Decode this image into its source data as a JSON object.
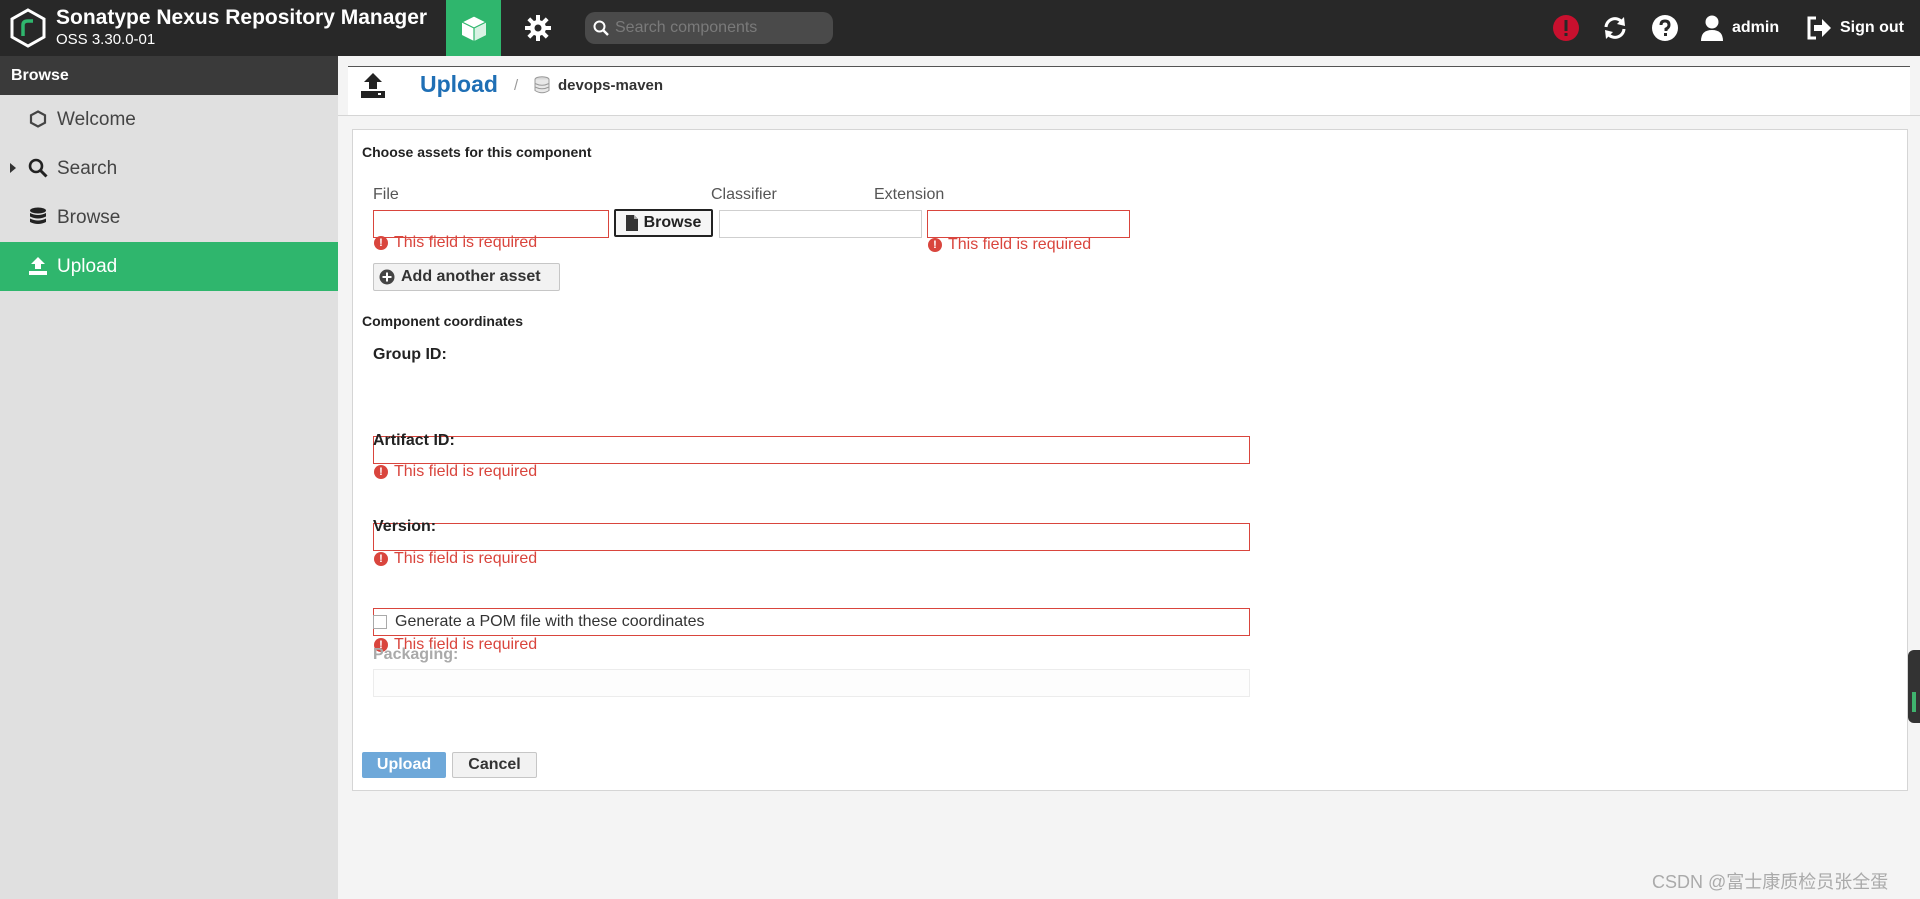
{
  "header": {
    "app_title": "Sonatype Nexus Repository Manager",
    "version": "OSS 3.30.0-01",
    "search_placeholder": "Search components",
    "user_name": "admin",
    "sign_out_label": "Sign out",
    "icons": [
      "nexus-logo-icon",
      "cube-icon",
      "gear-icon",
      "search-icon",
      "alert-icon",
      "refresh-icon",
      "help-icon",
      "user-icon",
      "sign-out-icon"
    ],
    "accent_color": "#2fb66d"
  },
  "sidebar": {
    "header": "Browse",
    "items": [
      {
        "label": "Welcome",
        "icon": "hexagon-icon"
      },
      {
        "label": "Search",
        "icon": "search-icon"
      },
      {
        "label": "Browse",
        "icon": "database-icon"
      },
      {
        "label": "Upload",
        "icon": "upload-icon",
        "active": true
      }
    ]
  },
  "title_bar": {
    "title": "Upload",
    "separator": "/",
    "repository": "devops-maven"
  },
  "form": {
    "assets_section_title": "Choose assets for this component",
    "file_label": "File",
    "classifier_label": "Classifier",
    "extension_label": "Extension",
    "browse_label": "Browse",
    "required_error": "This field is required",
    "add_asset_label": "Add another asset",
    "coordinates_section_title": "Component coordinates",
    "group_id_label": "Group ID:",
    "artifact_id_label": "Artifact ID:",
    "version_label": "Version:",
    "pom_checkbox_label": "Generate a POM file with these coordinates",
    "pom_checked": false,
    "packaging_label": "Packaging:",
    "upload_label": "Upload",
    "cancel_label": "Cancel",
    "error_color": "#d9453d",
    "upload_button_color": "#6ea8d9"
  },
  "watermark": "CSDN @富士康质检员张全蛋"
}
